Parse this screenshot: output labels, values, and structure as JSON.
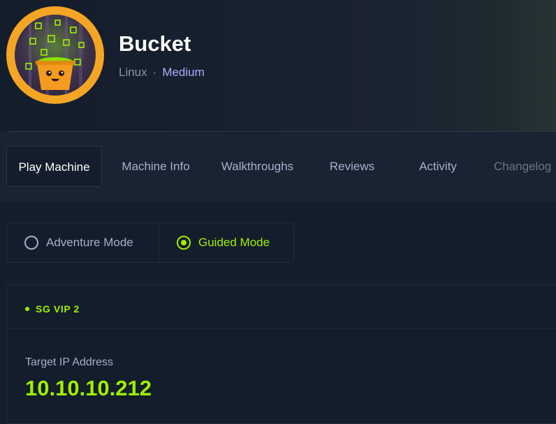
{
  "machine": {
    "name": "Bucket",
    "os": "Linux",
    "separator": "·",
    "difficulty": "Medium",
    "avatar_icon": "bucket-avatar-icon"
  },
  "tabs": [
    {
      "label": "Play Machine",
      "active": true
    },
    {
      "label": "Machine Info",
      "active": false
    },
    {
      "label": "Walkthroughs",
      "active": false
    },
    {
      "label": "Reviews",
      "active": false
    },
    {
      "label": "Activity",
      "active": false
    },
    {
      "label": "Changelog",
      "active": false
    }
  ],
  "modes": [
    {
      "label": "Adventure Mode",
      "selected": false
    },
    {
      "label": "Guided Mode",
      "selected": true
    }
  ],
  "connection": {
    "server": "SG VIP 2",
    "target_label": "Target IP Address",
    "target_ip": "10.10.10.212"
  },
  "colors": {
    "accent": "#9fef00",
    "background": "#141d2b",
    "avatar_ring": "#f5a524",
    "difficulty": "#a4b1ff"
  }
}
